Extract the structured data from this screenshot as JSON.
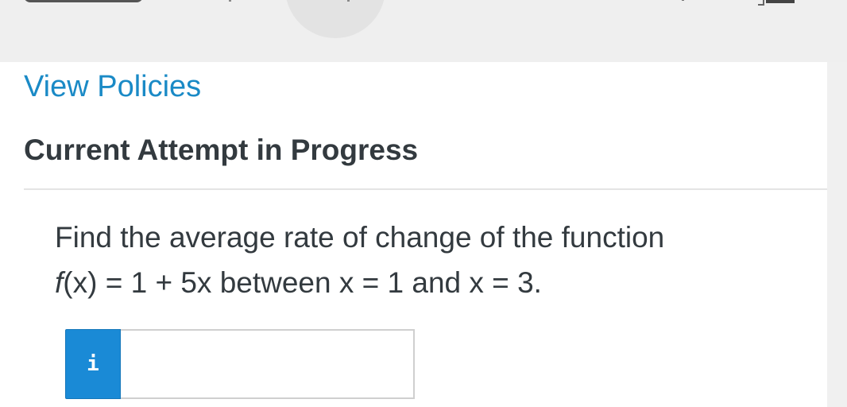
{
  "links": {
    "view_policies": "View Policies"
  },
  "attempt": {
    "heading": "Current Attempt in Progress"
  },
  "question": {
    "line1": "Find the average rate of change of the function",
    "fn_name": "f",
    "fn_rest": "(x) = 1 + 5x between x = 1 and x = 3."
  },
  "answer": {
    "info_icon": "i",
    "value": ""
  },
  "colors": {
    "link": "#1a8ac6",
    "info_button": "#1a8ad6",
    "heading_text": "#333a3f"
  }
}
